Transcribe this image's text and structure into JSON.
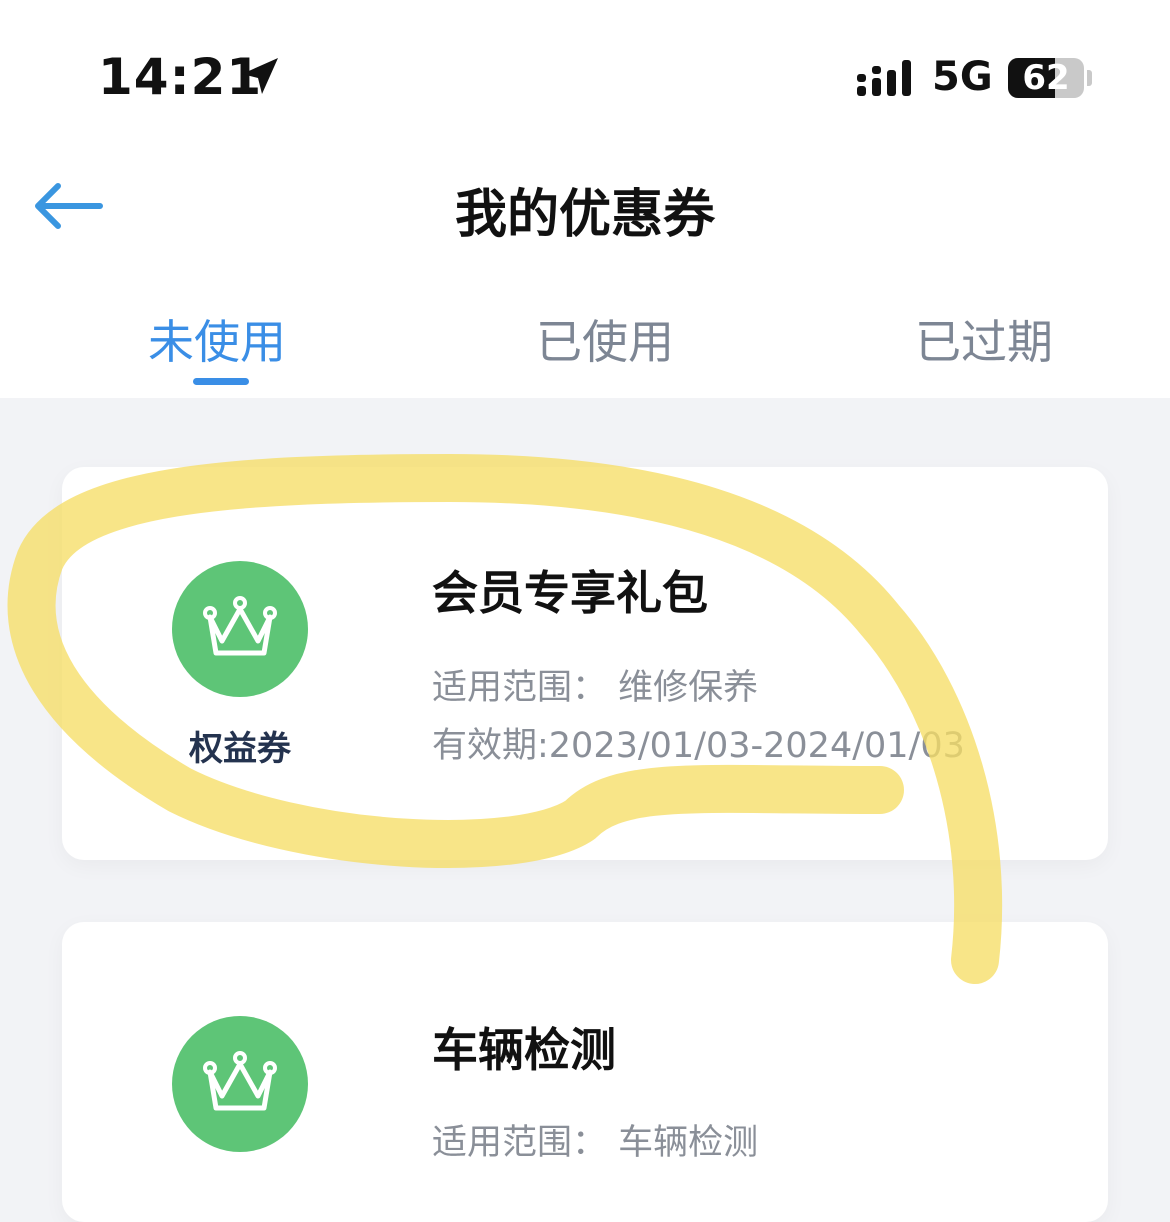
{
  "status_bar": {
    "time": "14:21",
    "network": "5G",
    "battery": "62",
    "battery_level": 0.62
  },
  "header": {
    "title": "我的优惠券"
  },
  "tabs": [
    {
      "label": "未使用",
      "active": true
    },
    {
      "label": "已使用",
      "active": false
    },
    {
      "label": "已过期",
      "active": false
    }
  ],
  "coupons": [
    {
      "badge_label": "权益券",
      "title": "会员专享礼包",
      "scope": "适用范围：  维修保养",
      "validity": "有效期:2023/01/03-2024/01/03"
    },
    {
      "title": "车辆检测",
      "scope": "适用范围：  车辆检测"
    }
  ],
  "colors": {
    "accent": "#3a8ee6",
    "badge_green": "#5ec577",
    "background": "#f2f3f6",
    "highlight_yellow": "#f6de66"
  },
  "icons": {
    "back": "back-arrow-icon",
    "location": "location-arrow-icon",
    "signal": "signal-icon",
    "battery": "battery-icon",
    "coupon_badge": "crown-icon"
  }
}
